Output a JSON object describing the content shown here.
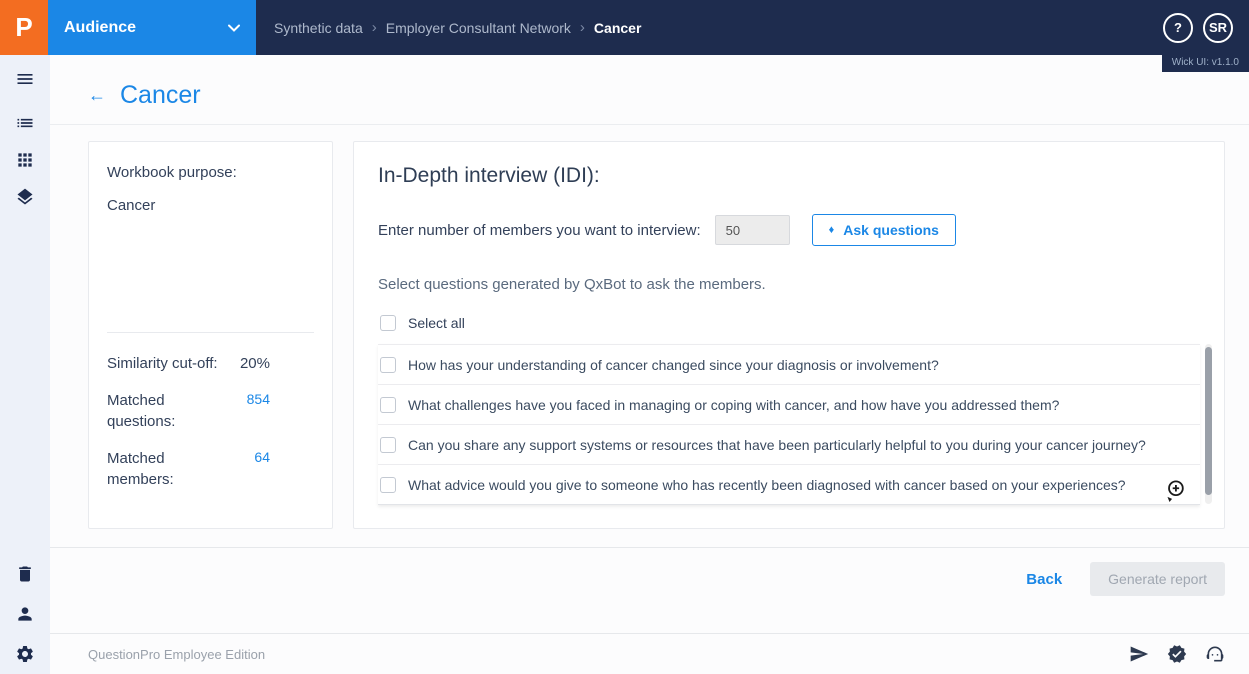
{
  "topbar": {
    "logo_letter": "P",
    "product_name": "Audience",
    "breadcrumb": {
      "separator": "›",
      "items": [
        "Synthetic data",
        "Employer Consultant Network",
        "Cancer"
      ]
    },
    "help_label": "?",
    "avatar_initials": "SR"
  },
  "version_label": "Wick UI: v1.1.0",
  "page": {
    "back_arrow": "←",
    "title": "Cancer"
  },
  "summary": {
    "purpose_label": "Workbook purpose:",
    "purpose_value": "Cancer",
    "similarity": {
      "label": "Similarity cut-off:",
      "value": "20%"
    },
    "matched_questions": {
      "label": "Matched questions:",
      "value": "854"
    },
    "matched_members": {
      "label": "Matched members:",
      "value": "64"
    }
  },
  "idi": {
    "title": "In-Depth interview (IDI):",
    "member_count_label": "Enter number of members you want to interview:",
    "member_count_value": "50",
    "ask_questions_icon": "♦",
    "ask_questions_label": "Ask questions",
    "instructions": "Select questions generated by QxBot to ask the members.",
    "select_all_label": "Select all",
    "questions": [
      "How has your understanding of cancer changed since your diagnosis or involvement?",
      "What challenges have you faced in managing or coping with cancer, and how have you addressed them?",
      "Can you share any support systems or resources that have been particularly helpful to you during your cancer journey?",
      "What advice would you give to someone who has recently been diagnosed with cancer based on your experiences?"
    ]
  },
  "actions": {
    "back_label": "Back",
    "generate_report_label": "Generate report"
  },
  "footer": {
    "edition_label": "QuestionPro Employee Edition"
  },
  "colors": {
    "accent_blue": "#1b87e6",
    "brand_orange": "#f36d21",
    "topbar_navy": "#1e2c4e",
    "text_dark": "#33415a",
    "disabled_button_bg": "#e8eaed"
  }
}
